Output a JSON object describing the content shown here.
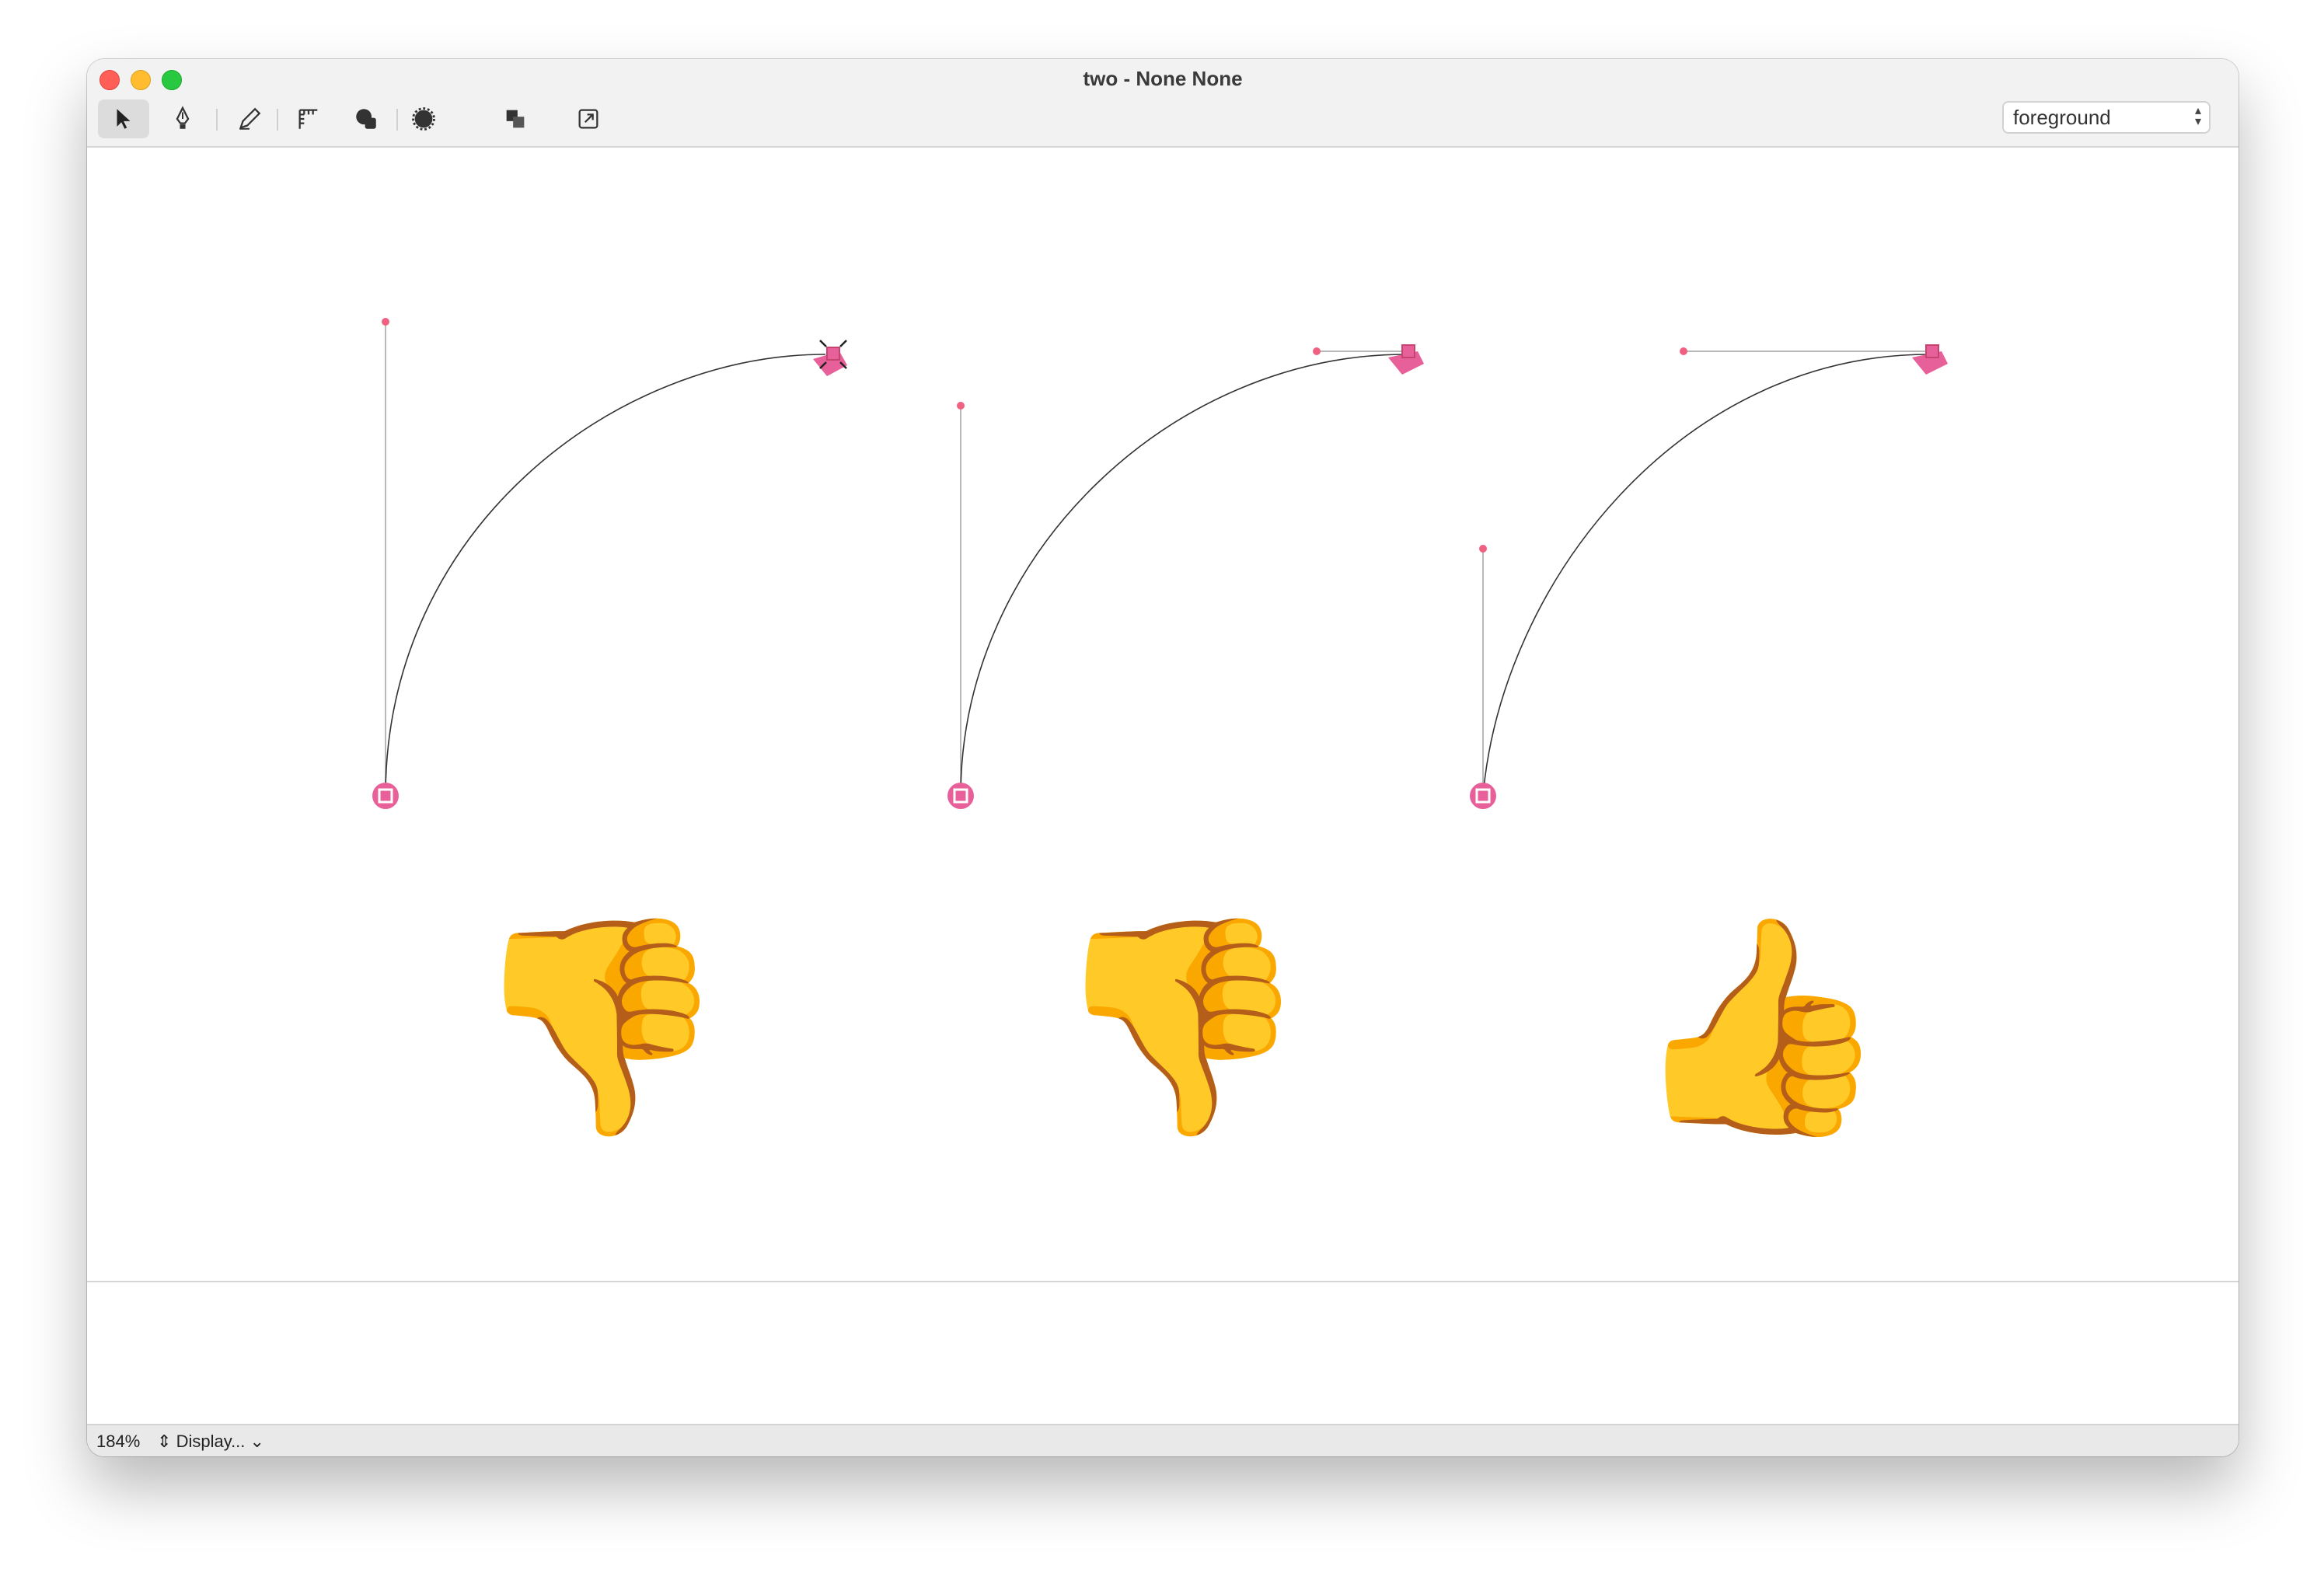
{
  "window": {
    "title": "two - None None"
  },
  "toolbar": {
    "tools": [
      {
        "name": "pointer",
        "icon": "arrow-pointer-icon",
        "selected": true
      },
      {
        "name": "pen",
        "icon": "pen-nib-icon",
        "selected": false
      },
      {
        "name": "pencil",
        "icon": "pencil-icon",
        "selected": false
      },
      {
        "name": "guides",
        "icon": "ruler-guide-icon",
        "selected": false
      },
      {
        "name": "shapes",
        "icon": "shapes-icon",
        "selected": false
      },
      {
        "name": "knife",
        "icon": "scallop-shape-icon",
        "selected": false
      },
      {
        "name": "components",
        "icon": "overlap-squares-icon",
        "selected": false
      },
      {
        "name": "image",
        "icon": "frame-arrow-icon",
        "selected": false
      }
    ],
    "layer": "foreground"
  },
  "canvas": {
    "emojis": [
      "👎",
      "👎",
      "👍"
    ],
    "accent_color": "#e8609a"
  },
  "status": {
    "zoom": "184%",
    "display_label": "Display..."
  }
}
